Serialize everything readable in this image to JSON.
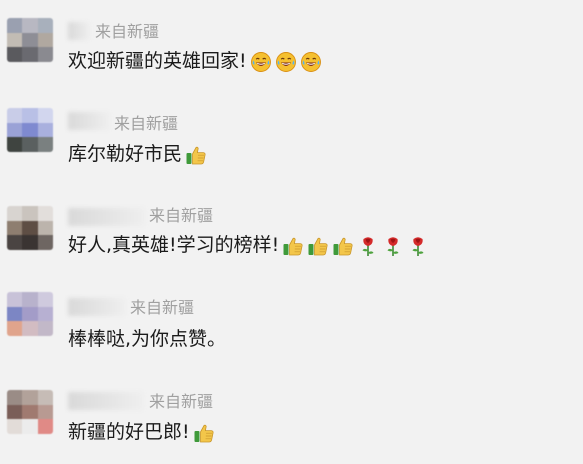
{
  "comments": [
    {
      "source": "来自新疆",
      "text": "欢迎新疆的英雄回家!",
      "emojis": [
        "grinning-tears-face-icon",
        "grinning-tears-face-icon",
        "grinning-tears-face-icon"
      ],
      "avatar_colors": [
        "#9aa0b0",
        "#b8b8c2",
        "#a8b0bc",
        "#c2bcb4",
        "#8e8e96",
        "#b0a8a0",
        "#5a5a5e",
        "#6a6a70",
        "#8a8a90"
      ]
    },
    {
      "source": "来自新疆",
      "text": "库尔勒好市民",
      "emojis": [
        "thumbs-up-icon"
      ],
      "avatar_colors": [
        "#c9cde8",
        "#b9c0e6",
        "#d2d6ee",
        "#9aa2d6",
        "#7f8ad0",
        "#a9b0de",
        "#3f4440",
        "#5a6060",
        "#7a8080"
      ]
    },
    {
      "source": "来自新疆",
      "text": "好人,真英雄!学习的榜样!",
      "emojis": [
        "thumbs-up-icon",
        "thumbs-up-icon",
        "thumbs-up-icon",
        "rose-icon",
        "rose-icon",
        "rose-icon"
      ],
      "avatar_colors": [
        "#d8d4d0",
        "#cac4be",
        "#e2dedb",
        "#8e7e70",
        "#5e4e44",
        "#bcb4ac",
        "#4a4442",
        "#3a3432",
        "#6e6662"
      ]
    },
    {
      "source": "来自新疆",
      "text": "棒棒哒,为你点赞。",
      "emojis": [],
      "avatar_colors": [
        "#c8c2d8",
        "#b8b2cc",
        "#cfcade",
        "#7c86c4",
        "#a39cc8",
        "#b7b0d2",
        "#e0a48c",
        "#d2bcc2",
        "#c2b8c8"
      ]
    },
    {
      "source": "来自新疆",
      "text": "新疆的好巴郎!",
      "emojis": [
        "thumbs-up-icon"
      ],
      "avatar_colors": [
        "#9a8c86",
        "#b2a29a",
        "#c6bcb6",
        "#7a5e58",
        "#a07a70",
        "#b89a92",
        "#e2dcd8",
        "#ececec",
        "#e08a86"
      ]
    }
  ],
  "colors": {
    "background": "#f2f2f2",
    "source_text": "#a0a0a0",
    "comment_text": "#1b1b1b"
  }
}
